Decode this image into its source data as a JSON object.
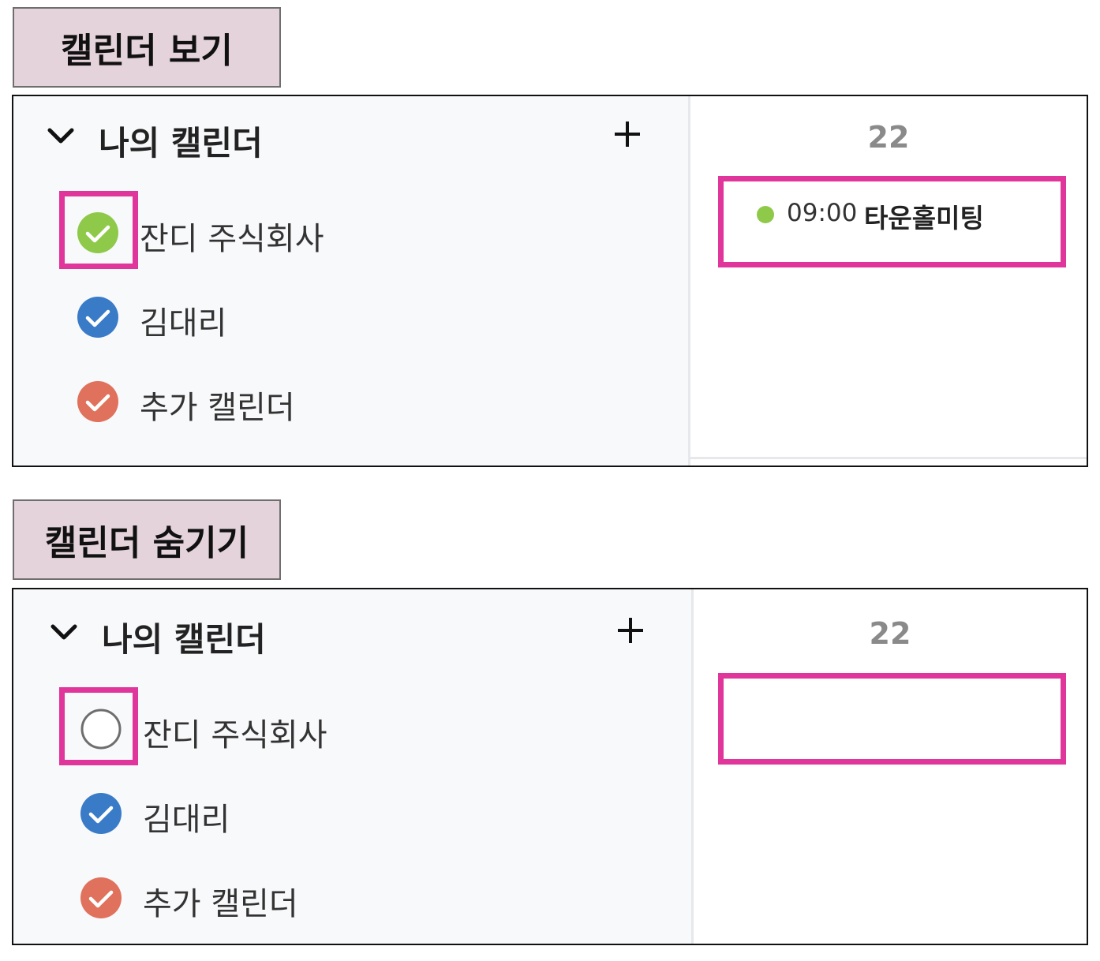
{
  "colors": {
    "highlight": "#e0359a",
    "label_bg": "#e5d3db",
    "green": "#8fc94a",
    "blue": "#3a7bc8",
    "orange": "#e0715c",
    "unchecked_ring": "#6e6e6e"
  },
  "view_section": {
    "label": "캘린더 보기",
    "panel": {
      "heading": "나의 캘린더",
      "add_icon": "plus-icon",
      "collapse_icon": "chevron-down-icon",
      "calendars": [
        {
          "label": "잔디 주식회사",
          "state": "checked",
          "color": "green"
        },
        {
          "label": "김대리",
          "state": "checked",
          "color": "blue"
        },
        {
          "label": "추가 캘린더",
          "state": "checked",
          "color": "orange"
        }
      ],
      "day": "22",
      "event": {
        "time": "09:00",
        "title": "타운홀미팅",
        "color": "green"
      }
    }
  },
  "hide_section": {
    "label": "캘린더 숨기기",
    "panel": {
      "heading": "나의 캘린더",
      "add_icon": "plus-icon",
      "collapse_icon": "chevron-down-icon",
      "calendars": [
        {
          "label": "잔디 주식회사",
          "state": "unchecked",
          "color": "green"
        },
        {
          "label": "김대리",
          "state": "checked",
          "color": "blue"
        },
        {
          "label": "추가 캘린더",
          "state": "checked",
          "color": "orange"
        }
      ],
      "day": "22"
    }
  }
}
